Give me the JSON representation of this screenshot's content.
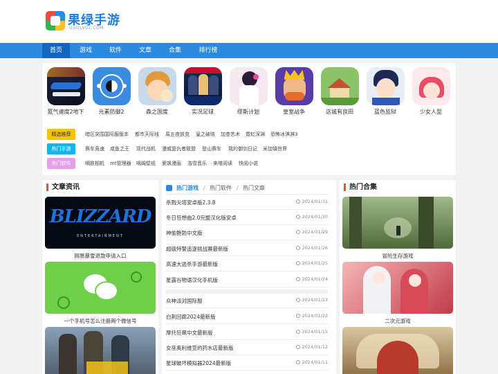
{
  "site": {
    "brand": "果绿手游",
    "sub": "GUOLVGL.COM"
  },
  "nav": [
    "首页",
    "游戏",
    "软件",
    "文章",
    "合集",
    "排行榜"
  ],
  "apps": [
    {
      "name": "氮气速度2地下",
      "icon": "racing-game-icon"
    },
    {
      "name": "元素防御2",
      "icon": "yin-yang-game-icon"
    },
    {
      "name": "森之国度",
      "icon": "anime-boy-icon"
    },
    {
      "name": "实况足球",
      "icon": "football-game-icon"
    },
    {
      "name": "缪斯计划",
      "icon": "muse-plan-icon"
    },
    {
      "name": "皇室战争",
      "icon": "clash-royale-icon"
    },
    {
      "name": "这城有良田",
      "icon": "farm-town-icon"
    },
    {
      "name": "蓝色监狱",
      "icon": "blue-lock-icon"
    },
    {
      "name": "少女人型",
      "icon": "anime-girl-icon"
    }
  ],
  "tag_rows": [
    {
      "tag": "精选推荐",
      "links": [
        "暗区突围国际服版本",
        "都市天际线",
        "周五夜放克",
        "皇之破晓",
        "加查艺术",
        "霓虹深渊",
        "恐怖冰淇淋3"
      ]
    },
    {
      "tag": "热门手游",
      "links": [
        "赛车竞速",
        "咸鱼之王",
        "现代战机",
        "漫威复仇者联盟",
        "登山赛车",
        "我的御剑日记",
        "米加镇世界"
      ]
    },
    {
      "tag": "热门软件",
      "links": [
        "嘀肤相机",
        "mt管理器",
        "嘀姆壁纸",
        "爱飒漫画",
        "洛雪音乐",
        "来塔阅读",
        "快阅小说"
      ]
    }
  ],
  "articles_panel": {
    "title": "文章资讯",
    "cards": [
      "网易暴雪退款申请入口",
      "一个手机号怎么注册两个微信号",
      ""
    ]
  },
  "middle_panel": {
    "tabs": [
      "热门游戏",
      "/",
      "热门软件",
      "/",
      "热门文章"
    ],
    "group1": [
      {
        "title": "杀戮尖塔安卓版2.3.8",
        "date": "2024/01/31"
      },
      {
        "title": "冬日狂想曲2.0完整汉化版安卓",
        "date": "2024/01/30"
      },
      {
        "title": "神偷鲍勃中文版",
        "date": "2024/01/29"
      },
      {
        "title": "超级特警追逐挑战赛最新版",
        "date": "2024/01/26"
      },
      {
        "title": "高速大逃杀手游最新版",
        "date": "2024/01/25"
      },
      {
        "title": "星露谷物语汉化手机版",
        "date": "2024/01/24"
      }
    ],
    "group2": [
      {
        "title": "众神派对国际服",
        "date": "2024/01/23"
      },
      {
        "title": "白荆回廊2024最新版",
        "date": "2024/01/22"
      },
      {
        "title": "摩托狂飙中文最新版",
        "date": "2024/01/15"
      },
      {
        "title": "女巫奥利维亚的药水店最新版",
        "date": "2024/01/12"
      },
      {
        "title": "星球破坏模拟器2024最新版",
        "date": "2024/01/11"
      }
    ]
  },
  "collections_panel": {
    "title": "热门合集",
    "cards": [
      "冒险生存游戏",
      "二次元游戏",
      ""
    ]
  },
  "colors": {
    "nav": "#2b8ae0",
    "nav_active": "#1366c0",
    "accent": "#e8542e",
    "tab_blue": "#2b8ae0"
  }
}
